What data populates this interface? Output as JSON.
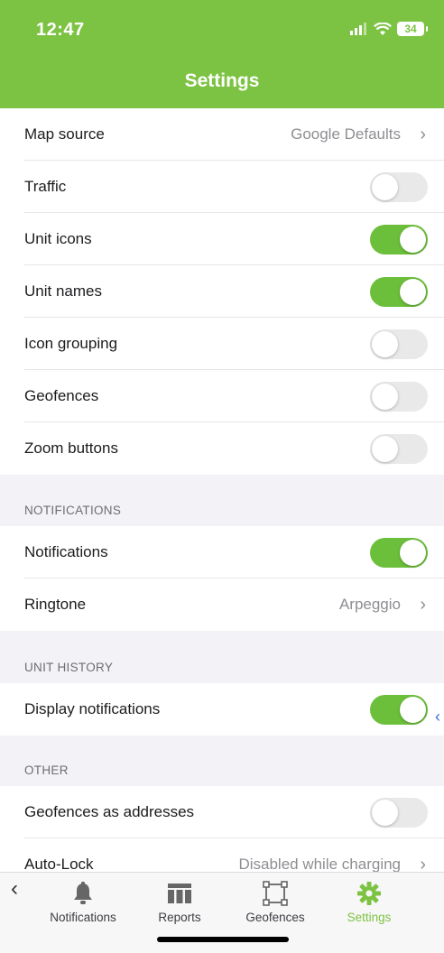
{
  "status_bar": {
    "time": "12:47",
    "battery": "34"
  },
  "header": {
    "title": "Settings"
  },
  "rows_top": [
    {
      "label": "Map source",
      "value": "Google Defaults",
      "type": "link"
    },
    {
      "label": "Traffic",
      "type": "toggle",
      "on": false
    },
    {
      "label": "Unit icons",
      "type": "toggle",
      "on": true
    },
    {
      "label": "Unit names",
      "type": "toggle",
      "on": true
    },
    {
      "label": "Icon grouping",
      "type": "toggle",
      "on": false
    },
    {
      "label": "Geofences",
      "type": "toggle",
      "on": false
    },
    {
      "label": "Zoom buttons",
      "type": "toggle",
      "on": false
    }
  ],
  "sections": {
    "notifications": {
      "title": "NOTIFICATIONS",
      "rows": [
        {
          "label": "Notifications",
          "type": "toggle",
          "on": true
        },
        {
          "label": "Ringtone",
          "value": "Arpeggio",
          "type": "link"
        }
      ]
    },
    "unit_history": {
      "title": "UNIT HISTORY",
      "rows": [
        {
          "label": "Display notifications",
          "type": "toggle",
          "on": true
        }
      ]
    },
    "other": {
      "title": "OTHER",
      "rows": [
        {
          "label": "Geofences as addresses",
          "type": "toggle",
          "on": false
        },
        {
          "label": "Auto-Lock",
          "value": "Disabled while charging",
          "type": "link"
        }
      ]
    }
  },
  "tabbar": {
    "tabs": [
      {
        "label": "Notifications",
        "icon": "bell-icon"
      },
      {
        "label": "Reports",
        "icon": "table-icon"
      },
      {
        "label": "Geofences",
        "icon": "geofence-icon"
      },
      {
        "label": "Settings",
        "icon": "gear-icon",
        "active": true
      }
    ]
  },
  "colors": {
    "accent": "#7dc343",
    "toggle_on": "#6cbf3a",
    "toggle_off": "#e9e9ea"
  }
}
